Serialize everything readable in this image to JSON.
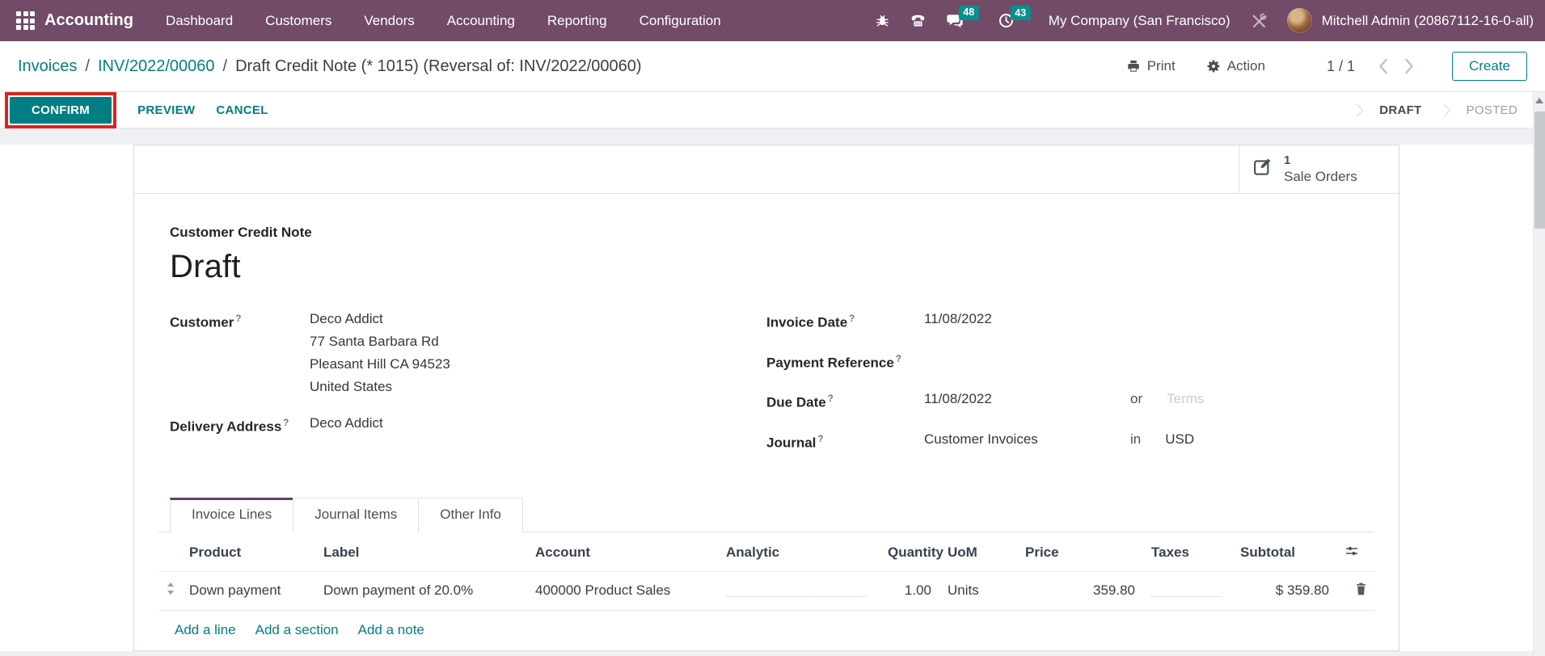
{
  "colors": {
    "navbar_bg": "#714B67",
    "accent_teal": "#017E84",
    "badge_teal": "#0A8F8F",
    "annotation_red": "#D9251D"
  },
  "navbar": {
    "app_name": "Accounting",
    "menu": [
      "Dashboard",
      "Customers",
      "Vendors",
      "Accounting",
      "Reporting",
      "Configuration"
    ],
    "messages_badge": "48",
    "activities_badge": "43",
    "company": "My Company (San Francisco)",
    "user": "Mitchell Admin (20867112-16-0-all)"
  },
  "control_panel": {
    "breadcrumb": {
      "link1": "Invoices",
      "link2": "INV/2022/00060",
      "separator": "/",
      "current": "Draft Credit Note (* 1015) (Reversal of: INV/2022/00060)"
    },
    "print_label": "Print",
    "action_label": "Action",
    "pager": "1 / 1",
    "create_label": "Create"
  },
  "statusbar": {
    "confirm_label": "CONFIRM",
    "preview_label": "PREVIEW",
    "cancel_label": "CANCEL",
    "states": [
      "DRAFT",
      "POSTED"
    ],
    "active_state": "DRAFT"
  },
  "sheet": {
    "stat_button": {
      "count": "1",
      "label": "Sale Orders"
    },
    "doc_type": "Customer Credit Note",
    "doc_name": "Draft",
    "fields": {
      "help_marker": "?",
      "customer_label": "Customer",
      "customer_name": "Deco Addict",
      "address_line1": "77 Santa Barbara Rd",
      "address_line2": "Pleasant Hill CA 94523",
      "address_line3": "United States",
      "delivery_label": "Delivery Address",
      "delivery_value": "Deco Addict",
      "invoice_date_label": "Invoice Date",
      "invoice_date": "11/08/2022",
      "payment_ref_label": "Payment Reference",
      "due_date_label": "Due Date",
      "due_date": "11/08/2022",
      "or_label": "or",
      "terms_placeholder": "Terms",
      "journal_label": "Journal",
      "journal_value": "Customer Invoices",
      "in_label": "in",
      "currency": "USD"
    },
    "tabs": [
      "Invoice Lines",
      "Journal Items",
      "Other Info"
    ],
    "invoice_lines": {
      "headers": [
        "Product",
        "Label",
        "Account",
        "Analytic",
        "Quantity",
        "UoM",
        "Price",
        "Taxes",
        "Subtotal"
      ],
      "rows": [
        {
          "product": "Down payment",
          "label": "Down payment of 20.0%",
          "account": "400000 Product Sales",
          "analytic": "",
          "quantity": "1.00",
          "uom": "Units",
          "price": "359.80",
          "taxes": "",
          "subtotal": "$ 359.80"
        }
      ],
      "add_line": "Add a line",
      "add_section": "Add a section",
      "add_note": "Add a note"
    }
  }
}
